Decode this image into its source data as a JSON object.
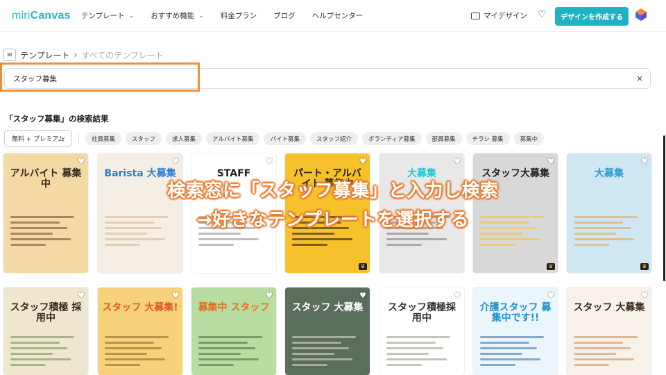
{
  "header": {
    "logo_light": "miri",
    "logo_bold": "Canvas",
    "nav": [
      {
        "label": "テンプレート",
        "has_menu": true
      },
      {
        "label": "おすすめ機能",
        "has_menu": true
      },
      {
        "label": "料金プラン",
        "has_menu": false
      },
      {
        "label": "ブログ",
        "has_menu": false
      },
      {
        "label": "ヘルプセンター",
        "has_menu": false
      }
    ],
    "my_design": "マイデザイン",
    "create_button": "デザインを作成する",
    "accent_color": "#1eb3c3"
  },
  "breadcrumb": {
    "root": "テンプレート",
    "current": "すべてのテンプレート"
  },
  "search": {
    "value": "スタッフ募集",
    "clear": "×"
  },
  "results": {
    "title": "「スタッフ募集」の検索結果"
  },
  "filters": {
    "plan": "無料 + プレミアム",
    "tags": [
      "社員募集",
      "スタッフ",
      "求人募集",
      "アルバイト募集",
      "バイト募集",
      "スタッフ紹介",
      "ボランティア募集",
      "部員募集",
      "チラシ 募集",
      "募集中"
    ]
  },
  "templates_row1": [
    {
      "title": "アルバイト 募集中",
      "bg": "#f3d9a4",
      "fg": "#3b2a1e",
      "accent": "#6b4423"
    },
    {
      "title": "Barista 大募集",
      "bg": "#f4eee4",
      "fg": "#2a7fd4",
      "accent": "#d9b48a"
    },
    {
      "title": "STAFF",
      "bg": "#ffffff",
      "fg": "#222222",
      "accent": "#888888"
    },
    {
      "title": "パート・アルバイト 募集中",
      "bg": "#f6c12b",
      "fg": "#222222",
      "accent": "#111111"
    },
    {
      "title": "大募集",
      "bg": "#e8e8e8",
      "fg": "#1ec8d6",
      "accent": "#777777"
    },
    {
      "title": "スタッフ大募集",
      "bg": "#d8d8d8",
      "fg": "#222222",
      "accent": "#f2c230"
    },
    {
      "title": "大募集",
      "bg": "#cfe6f3",
      "fg": "#2e9bd0",
      "accent": "#e1a53a"
    }
  ],
  "templates_row2": [
    {
      "title": "スタッフ積極 採用中",
      "bg": "#efe6cf",
      "fg": "#3b2a1e",
      "accent": "#6b8a4e"
    },
    {
      "title": "スタッフ 大募集!",
      "bg": "#f8d27a",
      "fg": "#e2572b",
      "accent": "#8a5a2b"
    },
    {
      "title": "募集中 スタッフ",
      "bg": "#b9dca0",
      "fg": "#e46f1f",
      "accent": "#3e6b33"
    },
    {
      "title": "スタッフ 大募集",
      "bg": "#5b6e5c",
      "fg": "#ffffff",
      "accent": "#e9e2d0"
    },
    {
      "title": "スタッフ積極採用中",
      "bg": "#ffffff",
      "fg": "#333333",
      "accent": "#9a8f86"
    },
    {
      "title": "介護スタッフ 募集中です!!",
      "bg": "#eaf6fb",
      "fg": "#1f8fd0",
      "accent": "#2b6a9c"
    },
    {
      "title": "スタッフ 大募集",
      "bg": "#f7f1ea",
      "fg": "#3b2a1e",
      "accent": "#c58a54"
    }
  ],
  "overlay": {
    "line1": "検索窓に「スタッフ募集」と入力し検索",
    "line2": "→好きなテンプレートを選択する",
    "outline_color": "#e87a2e"
  }
}
